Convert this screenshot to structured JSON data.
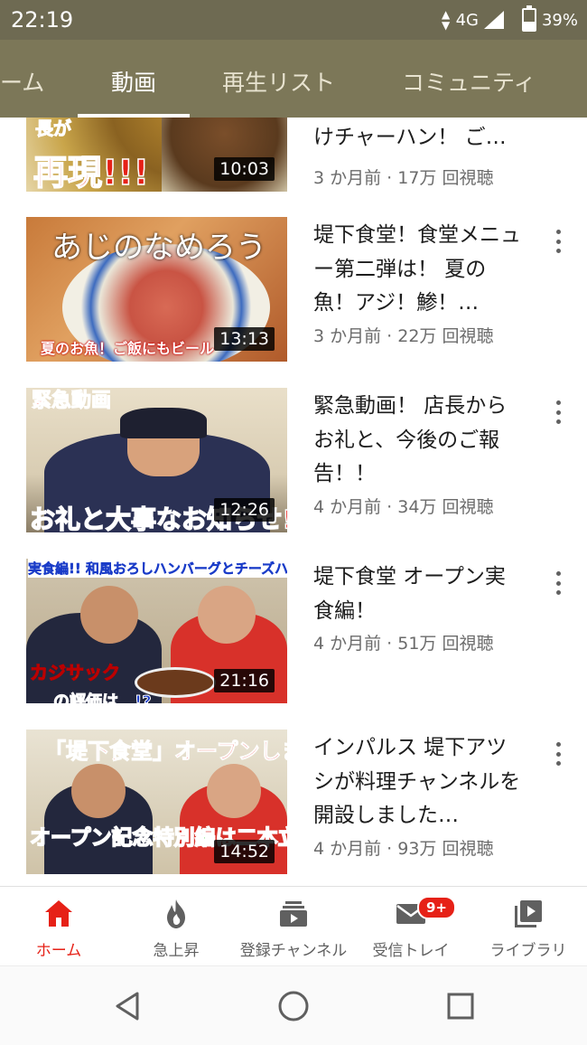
{
  "status": {
    "time": "22:19",
    "network": "4G",
    "battery": "39%",
    "battery_level": 0.39
  },
  "tabs": [
    {
      "label": "ーム",
      "active": false
    },
    {
      "label": "動画",
      "active": true
    },
    {
      "label": "再生リスト",
      "active": false
    },
    {
      "label": "コミュニティ",
      "active": false
    }
  ],
  "videos": [
    {
      "title": "けチャーハン！ ご…",
      "meta": "3 か月前 · 17万 回視聴",
      "duration": "10:03",
      "thumb_text": [
        "長が",
        "再現!!!"
      ]
    },
    {
      "title": "堤下食堂！食堂メニュー第二弾は！ 夏の魚！アジ！鯵！…",
      "meta": "3 か月前 · 22万 回視聴",
      "duration": "13:13",
      "thumb_text": [
        "あじのなめろう",
        "夏のお魚！ご飯にもビール"
      ]
    },
    {
      "title": "緊急動画！ 店長からお礼と、今後のご報告！！",
      "meta": "4 か月前 · 34万 回視聴",
      "duration": "12:26",
      "thumb_text": [
        "緊急動画",
        "お礼と大事なお知らせ!!"
      ]
    },
    {
      "title": "堤下食堂 オープン実食編！",
      "meta": "4 か月前 · 51万 回視聴",
      "duration": "21:16",
      "thumb_text": [
        "実食編!! 和風おろしハンバーグとチーズハンバーグ",
        "カジサック",
        "の評価は…!?"
      ]
    },
    {
      "title": "インパルス 堤下アツシが料理チャンネルを開設しました…",
      "meta": "4 か月前 · 93万 回視聴",
      "duration": "14:52",
      "thumb_text": [
        "「堤下食堂」オープンします！",
        "オープン記念特別編は二本立て!!"
      ]
    }
  ],
  "bottom_nav": [
    {
      "label": "ホーム",
      "icon": "home-icon",
      "active": true
    },
    {
      "label": "急上昇",
      "icon": "flame-icon",
      "active": false
    },
    {
      "label": "登録チャンネル",
      "icon": "subscriptions-icon",
      "active": false
    },
    {
      "label": "受信トレイ",
      "icon": "mail-icon",
      "active": false,
      "badge": "9+"
    },
    {
      "label": "ライブラリ",
      "icon": "library-icon",
      "active": false
    }
  ],
  "system_nav": {
    "back_icon": "back-triangle-icon",
    "home_icon": "home-circle-icon",
    "recents_icon": "recents-square-icon"
  },
  "colors": {
    "header": "#7c7758",
    "status_bar": "#6e6a52",
    "accent": "#e62117"
  }
}
